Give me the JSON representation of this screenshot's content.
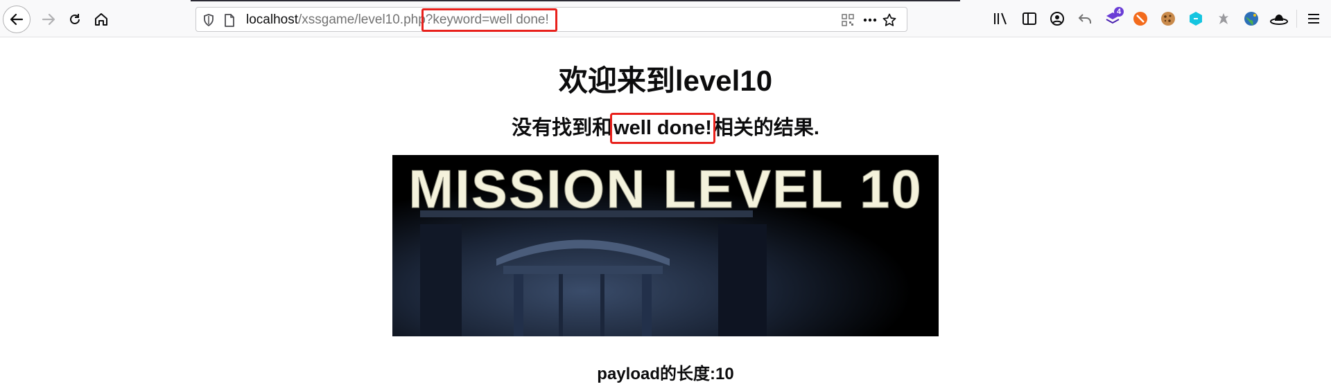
{
  "browser": {
    "url_host": "localhost",
    "url_path": "/xssgame/level10.php",
    "url_query": "?keyword=well done!",
    "badge_count": "4",
    "icons": [
      "back-arrow-icon",
      "forward-arrow-icon",
      "reload-icon",
      "home-icon",
      "shield-icon",
      "page-icon",
      "qr-code-icon",
      "more-icon",
      "star-icon",
      "library-icon",
      "sidebar-icon",
      "account-icon",
      "undo-icon",
      "extension-icon",
      "extension-icon",
      "cookie-icon",
      "extension-icon",
      "extension-icon",
      "globe-icon",
      "hat-icon",
      "menu-icon"
    ]
  },
  "page": {
    "title": "欢迎来到level10",
    "result_prefix": "没有找到和",
    "keyword": "well done!",
    "result_suffix": "相关的结果.",
    "banner_text": "MISSION LEVEL 10",
    "payload_label": "payload的长度:",
    "payload_length": "10"
  },
  "colors": {
    "highlight": "#e8201b",
    "banner_text": "#f4f2dc"
  }
}
